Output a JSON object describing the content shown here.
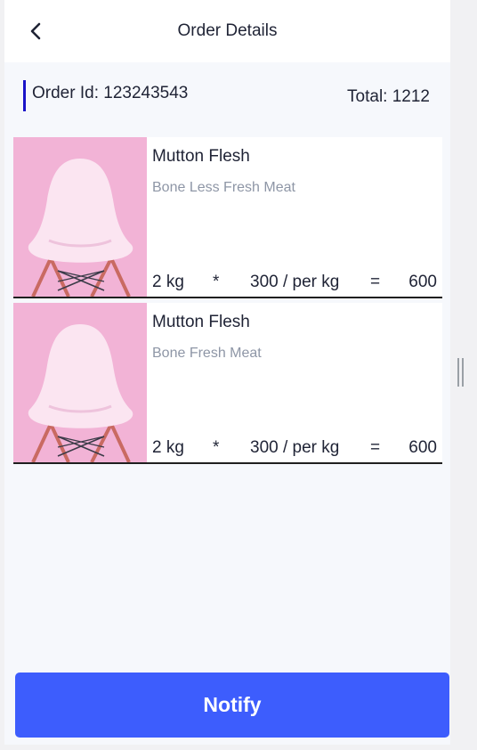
{
  "header": {
    "title": "Order Details",
    "back_icon": "chevron-left-icon"
  },
  "order": {
    "id_text": "Order Id: 123243543",
    "total_text": "Total: 1212"
  },
  "items": [
    {
      "name": "Mutton Flesh",
      "description": "Bone Less Fresh Meat",
      "quantity": "2 kg",
      "multiply": "*",
      "price": "300 / per kg",
      "equals": "=",
      "subtotal": "600"
    },
    {
      "name": "Mutton Flesh",
      "description": "Bone Fresh Meat",
      "quantity": "2 kg",
      "multiply": "*",
      "price": "300 / per kg",
      "equals": "=",
      "subtotal": "600"
    }
  ],
  "actions": {
    "notify_label": "Notify"
  },
  "colors": {
    "accent_bar": "#1a14c8",
    "notify_button": "#3d5dfd",
    "image_background": "#f2b3d6"
  }
}
